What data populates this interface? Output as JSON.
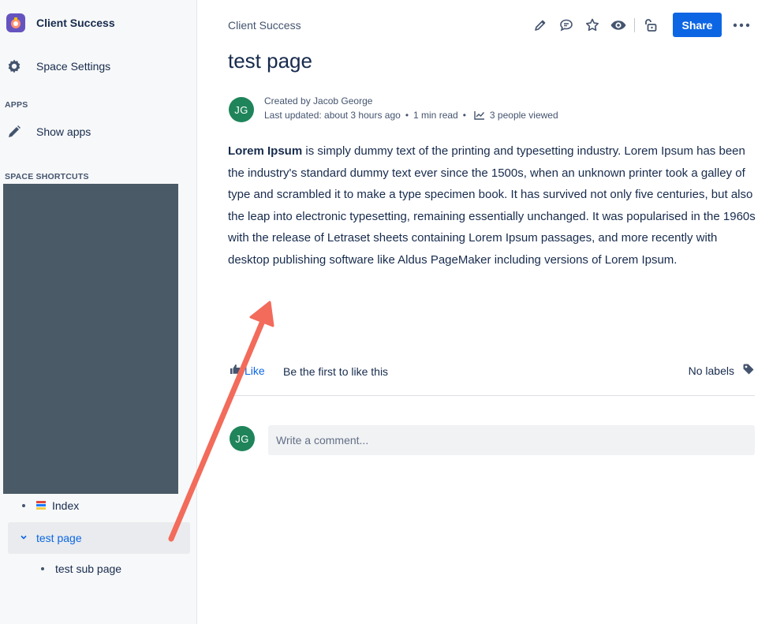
{
  "sidebar": {
    "space_title": "Client Success",
    "space_settings": "Space Settings",
    "apps_section": "APPS",
    "show_apps": "Show apps",
    "shortcuts_section": "SPACE SHORTCUTS",
    "tree": {
      "index": "Index",
      "test_page": "test page",
      "test_sub_page": "test sub page"
    }
  },
  "header": {
    "breadcrumb": "Client Success",
    "share_label": "Share",
    "icons": [
      "pencil-icon",
      "comment-icon",
      "star-icon",
      "eye-icon",
      "unlock-icon",
      "more-icon"
    ]
  },
  "page": {
    "title": "test page",
    "avatar_initials": "JG",
    "created_by": "Created by Jacob George",
    "last_updated": "Last updated: about 3 hours ago",
    "read_time": "1 min read",
    "views": "3 people viewed",
    "body_bold": "Lorem Ipsum",
    "body_rest": " is simply dummy text of the printing and typesetting industry. Lorem Ipsum has been the industry's standard dummy text ever since the 1500s, when an unknown printer took a galley of type and scrambled it to make a type specimen book. It has survived not only five centuries, but also the leap into electronic typesetting, remaining essentially unchanged. It was popularised in the 1960s with the release of Letraset sheets containing Lorem Ipsum passages, and more recently with desktop publishing software like Aldus PageMaker including versions of Lorem Ipsum."
  },
  "footer": {
    "like_label": "Like",
    "like_text": "Be the first to like this",
    "labels_text": "No labels",
    "comment_placeholder": "Write a comment..."
  },
  "colors": {
    "primary": "#0c66e4",
    "avatar": "#1f845a",
    "annotation": "#f26b5b",
    "redacted_block": "#4a5a66"
  }
}
